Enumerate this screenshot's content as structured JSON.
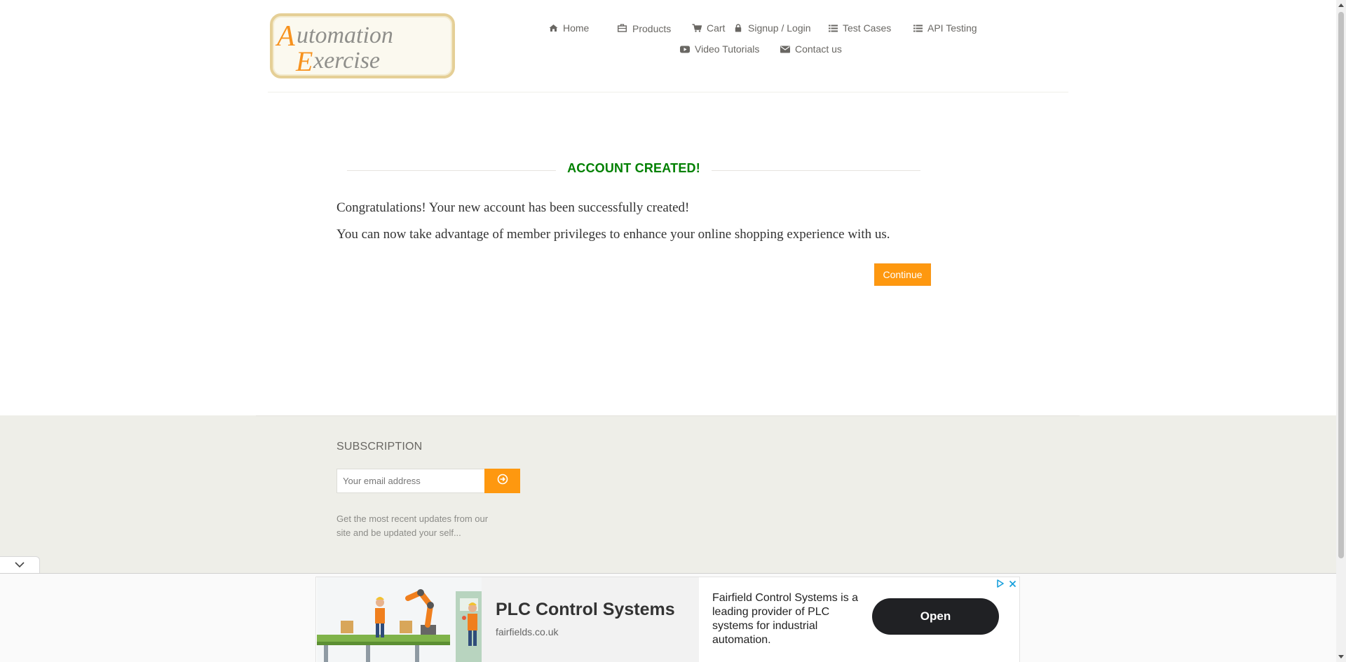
{
  "logo": {
    "line1": "Automation",
    "line2": "Exercise",
    "brand_orange": "#f7921e",
    "brand_gray": "#8f8f8b"
  },
  "nav": {
    "items": [
      {
        "label": "Home",
        "icon": "home-icon"
      },
      {
        "label": "Products",
        "icon": "products-icon"
      },
      {
        "label": "Cart",
        "icon": "cart-icon"
      },
      {
        "label": "Signup / Login",
        "icon": "lock-icon"
      },
      {
        "label": "Test Cases",
        "icon": "list-icon"
      },
      {
        "label": "API Testing",
        "icon": "list-icon"
      },
      {
        "label": "Video Tutorials",
        "icon": "youtube-icon"
      },
      {
        "label": "Contact us",
        "icon": "envelope-icon"
      }
    ]
  },
  "main": {
    "title": "ACCOUNT CREATED!",
    "title_color": "#008000",
    "message_1": "Congratulations! Your new account has been successfully created!",
    "message_2": "You can now take advantage of member privileges to enhance your online shopping experience with us.",
    "continue_label": "Continue",
    "accent": "#fe980f"
  },
  "footer": {
    "subscription_title": "SUBSCRIPTION",
    "email_placeholder": "Your email address",
    "subscribe_icon": "arrow-circle-right-icon",
    "description": "Get the most recent updates from our site and be updated your self..."
  },
  "ad": {
    "title": "PLC Control Systems",
    "url": "fairfields.co.uk",
    "description": "Fairfield Control Systems is a leading provider of PLC systems for industrial automation.",
    "cta": "Open"
  }
}
